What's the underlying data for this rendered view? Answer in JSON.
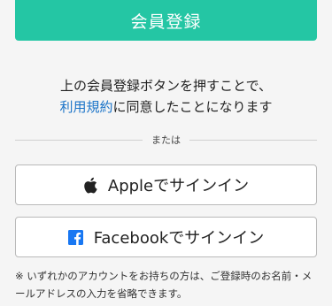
{
  "register": {
    "label": "会員登録"
  },
  "consent": {
    "line1": "上の会員登録ボタンを押すことで、",
    "terms_link": "利用規約",
    "line2_rest": "に同意したことになります"
  },
  "divider": {
    "label": "または"
  },
  "social": {
    "apple": {
      "label": "Appleでサインイン",
      "icon": "apple-logo-icon"
    },
    "facebook": {
      "label": "Facebookでサインイン",
      "icon": "facebook-logo-icon"
    }
  },
  "note": {
    "text": "※ いずれかのアカウントをお持ちの方は、ご登録時のお名前・メールアドレスの入力を省略できます。"
  },
  "colors": {
    "accent": "#24c6a4",
    "link": "#1a73c8",
    "facebook": "#1877f2"
  }
}
